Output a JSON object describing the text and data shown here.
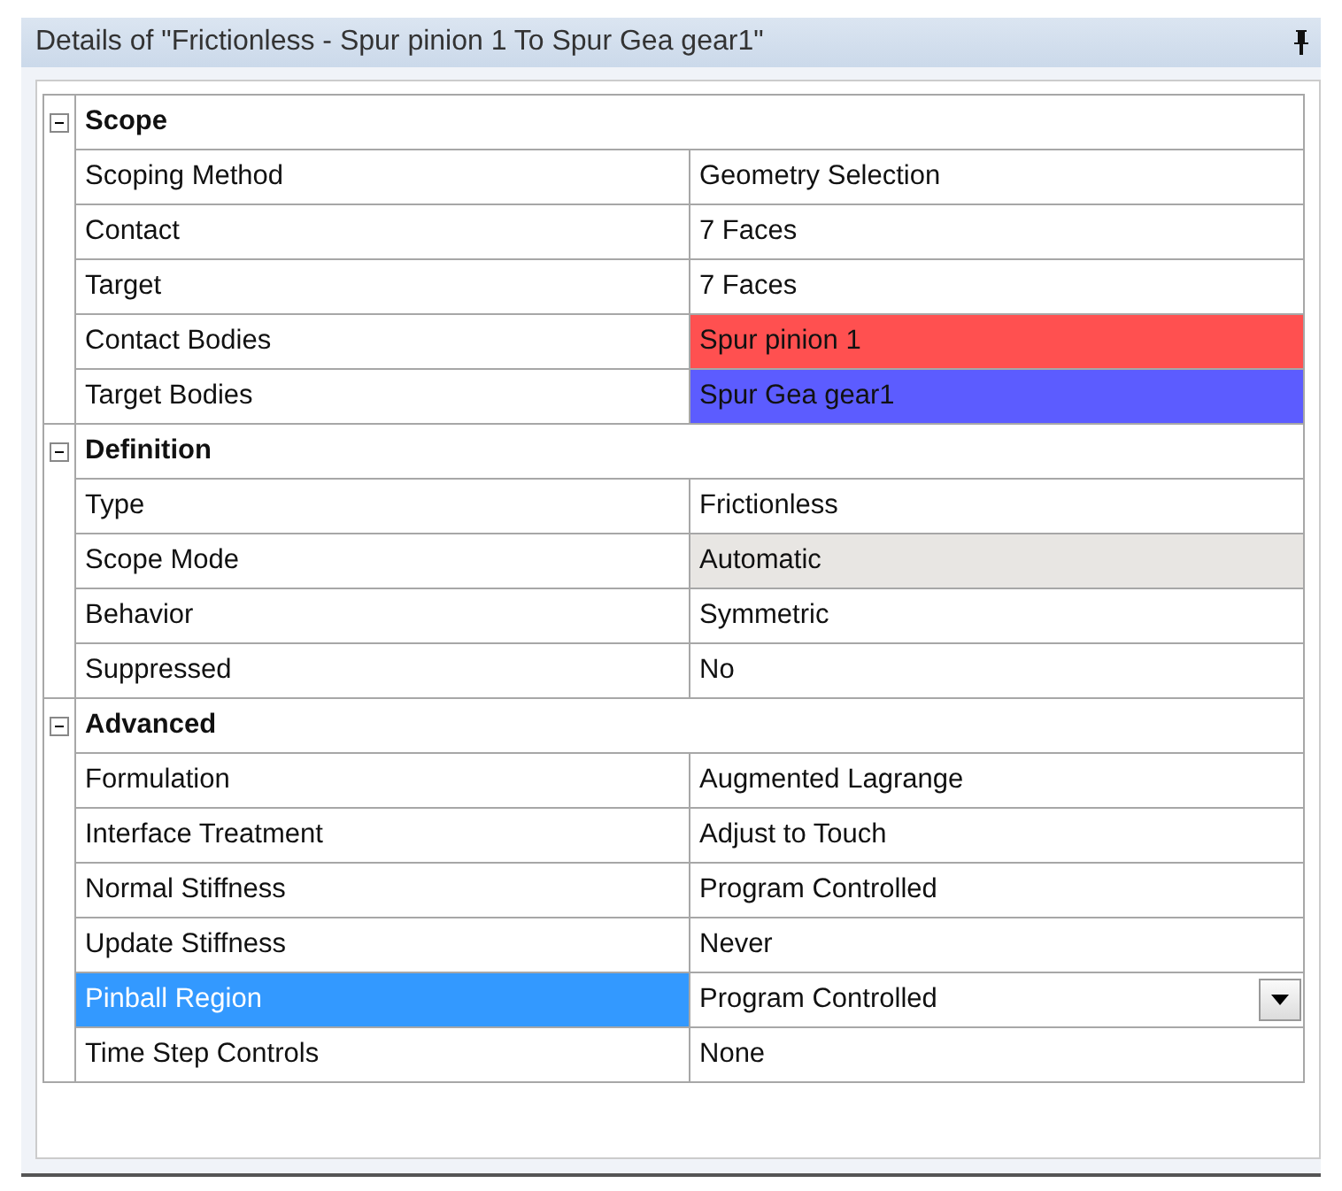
{
  "panel": {
    "title": "Details of \"Frictionless - Spur pinion 1 To Spur Gea gear1\"",
    "pinned": true
  },
  "sections": [
    {
      "name": "Scope",
      "expanded": true,
      "rows": [
        {
          "name": "Scoping Method",
          "value": "Geometry Selection",
          "kind": "text",
          "selected": false,
          "read_only": false
        },
        {
          "name": "Contact",
          "value": "7 Faces",
          "kind": "text",
          "selected": false,
          "read_only": false
        },
        {
          "name": "Target",
          "value": "7 Faces",
          "kind": "text",
          "selected": false,
          "read_only": false
        },
        {
          "name": "Contact Bodies",
          "value": "Spur pinion 1",
          "kind": "text",
          "selected": false,
          "read_only": false,
          "color": "#ff5050"
        },
        {
          "name": "Target Bodies",
          "value": "Spur Gea gear1",
          "kind": "text",
          "selected": false,
          "read_only": false,
          "color": "#5c5cff"
        }
      ]
    },
    {
      "name": "Definition",
      "expanded": true,
      "rows": [
        {
          "name": "Type",
          "value": "Frictionless",
          "kind": "text",
          "selected": false,
          "read_only": false
        },
        {
          "name": "Scope Mode",
          "value": "Automatic",
          "kind": "text",
          "selected": false,
          "read_only": true
        },
        {
          "name": "Behavior",
          "value": "Symmetric",
          "kind": "text",
          "selected": false,
          "read_only": false
        },
        {
          "name": "Suppressed",
          "value": "No",
          "kind": "text",
          "selected": false,
          "read_only": false
        }
      ]
    },
    {
      "name": "Advanced",
      "expanded": true,
      "rows": [
        {
          "name": "Formulation",
          "value": "Augmented Lagrange",
          "kind": "text",
          "selected": false,
          "read_only": false
        },
        {
          "name": "Interface Treatment",
          "value": "Adjust to Touch",
          "kind": "text",
          "selected": false,
          "read_only": false
        },
        {
          "name": "Normal Stiffness",
          "value": "Program Controlled",
          "kind": "text",
          "selected": false,
          "read_only": false
        },
        {
          "name": "Update Stiffness",
          "value": "Never",
          "kind": "text",
          "selected": false,
          "read_only": false
        },
        {
          "name": "Pinball Region",
          "value": "Program Controlled",
          "kind": "dropdown",
          "selected": true,
          "read_only": false
        },
        {
          "name": "Time Step Controls",
          "value": "None",
          "kind": "text",
          "selected": false,
          "read_only": false
        }
      ]
    }
  ]
}
